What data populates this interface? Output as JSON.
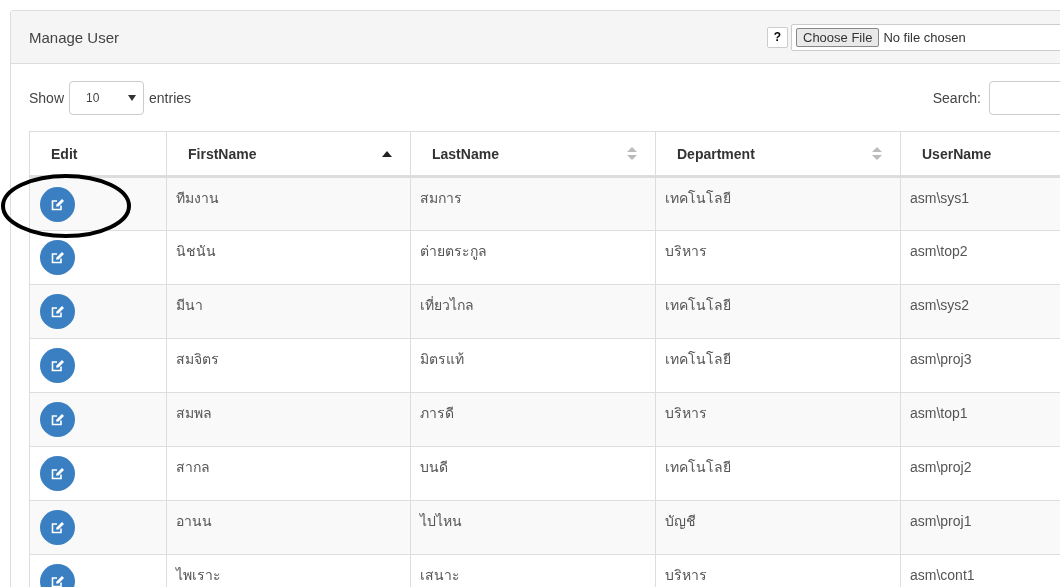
{
  "panel": {
    "title": "Manage User",
    "help_button": "?",
    "file_input": {
      "button": "Choose File",
      "status": "No file chosen"
    }
  },
  "length_menu": {
    "prefix": "Show",
    "value": "10",
    "suffix": "entries"
  },
  "search": {
    "label": "Search:"
  },
  "table": {
    "columns": [
      {
        "label": "Edit",
        "sortable": false
      },
      {
        "label": "FirstName",
        "sortable": true,
        "sorted_ascending": true
      },
      {
        "label": "LastName",
        "sortable": true,
        "sorted_ascending": false
      },
      {
        "label": "Department",
        "sortable": true,
        "sorted_ascending": false
      },
      {
        "label": "UserName"
      }
    ],
    "rows": [
      {
        "first": "ทีมงาน",
        "last": "สมการ",
        "department": "เทคโนโลยี",
        "username": "asm\\sys1",
        "circled": true
      },
      {
        "first": "นิชนัน",
        "last": "ต่ายตระกูล",
        "department": "บริหาร",
        "username": "asm\\top2",
        "circled": false
      },
      {
        "first": "มีนา",
        "last": "เที่ยวไกล",
        "department": "เทคโนโลยี",
        "username": "asm\\sys2",
        "circled": false
      },
      {
        "first": "สมจิตร",
        "last": "มิตรแท้",
        "department": "เทคโนโลยี",
        "username": "asm\\proj3",
        "circled": false
      },
      {
        "first": "สมพล",
        "last": "ภารดี",
        "department": "บริหาร",
        "username": "asm\\top1",
        "circled": false
      },
      {
        "first": "สากล",
        "last": "บนดี",
        "department": "เทคโนโลยี",
        "username": "asm\\proj2",
        "circled": false
      },
      {
        "first": "อานน",
        "last": "ไปไหน",
        "department": "บัญชี",
        "username": "asm\\proj1",
        "circled": false
      },
      {
        "first": "ไพเราะ",
        "last": "เสนาะ",
        "department": "บริหาร",
        "username": "asm\\cont1",
        "circled": false
      }
    ]
  }
}
